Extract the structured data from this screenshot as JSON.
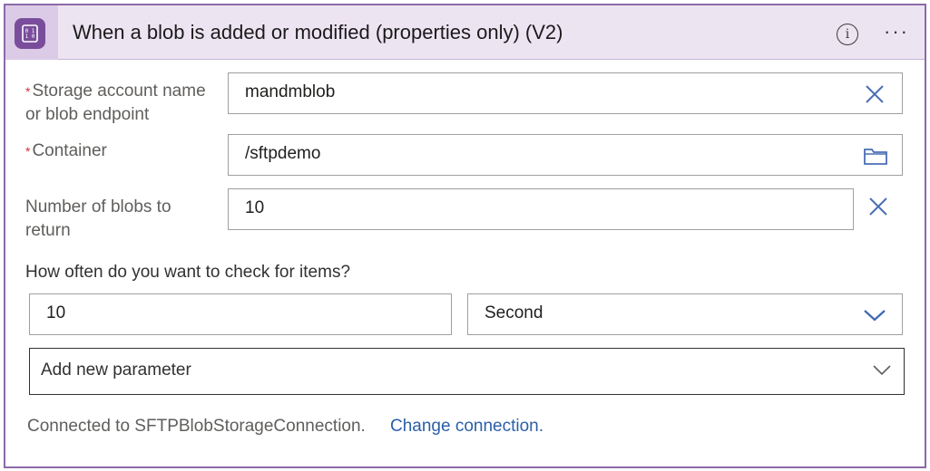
{
  "header": {
    "title": "When a blob is added or modified (properties only) (V2)",
    "icon": "blob-storage-icon",
    "accent": "#7a4d9c"
  },
  "fields": {
    "storage_account": {
      "label_line1": "Storage account name",
      "label_line2": "or blob endpoint",
      "required": "*",
      "value": "mandmblob"
    },
    "container": {
      "label": "Container",
      "required": "*",
      "value": "/sftpdemo"
    },
    "number_of_blobs": {
      "label_line1": "Number of blobs to",
      "label_line2": "return",
      "value": "10"
    }
  },
  "recurrence": {
    "question": "How often do you want to check for items?",
    "interval": "10",
    "frequency": "Second"
  },
  "add_parameter": {
    "label": "Add new parameter"
  },
  "footer": {
    "connected_text": "Connected to SFTPBlobStorageConnection.",
    "change_link": "Change connection."
  }
}
